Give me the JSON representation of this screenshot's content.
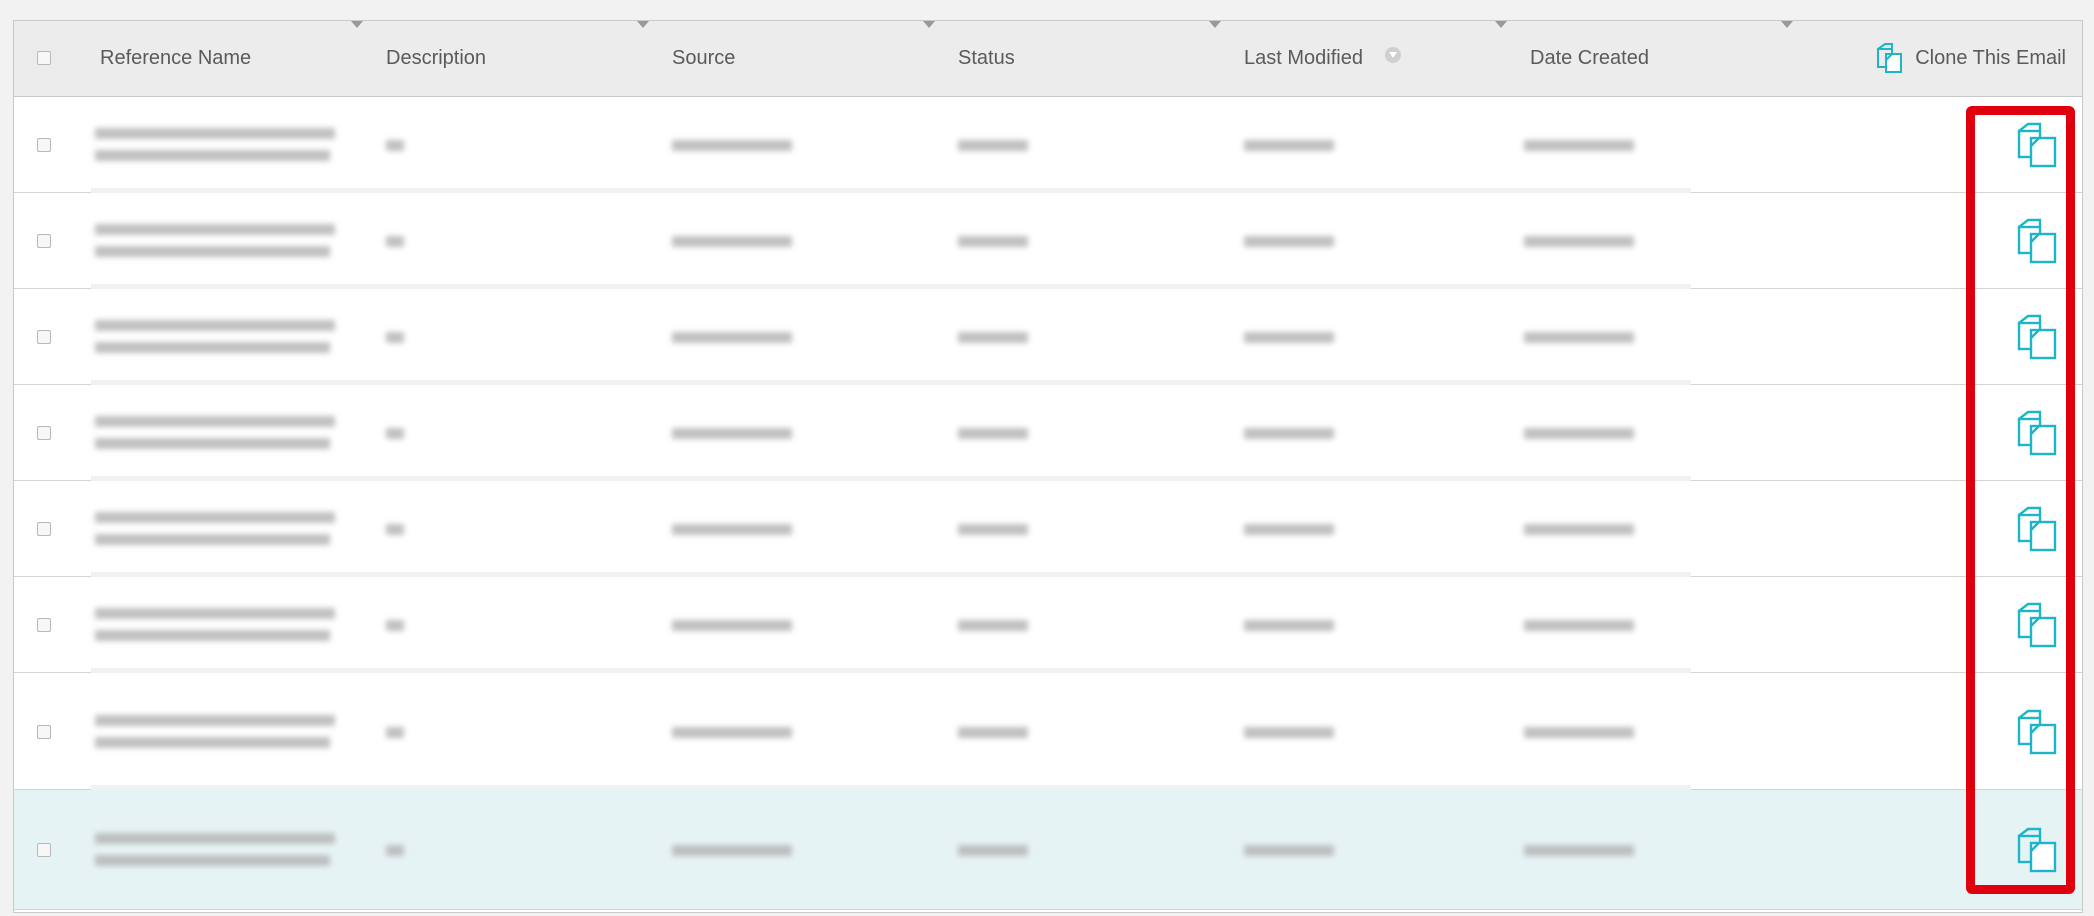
{
  "table": {
    "columns": [
      {
        "key": "reference_name",
        "label": "Reference Name"
      },
      {
        "key": "description",
        "label": "Description"
      },
      {
        "key": "source",
        "label": "Source"
      },
      {
        "key": "status",
        "label": "Status"
      },
      {
        "key": "last_modified",
        "label": "Last Modified"
      },
      {
        "key": "date_created",
        "label": "Date Created"
      }
    ],
    "clone_column_label": "Clone This Email",
    "sorted_column": "last_modified",
    "row_count": 8,
    "selected_row_index": 7,
    "row_text_note": "cell text obscured/blurred in screenshot"
  },
  "colors": {
    "accent": "#1fb5c9",
    "highlight_border": "#e0000d",
    "header_bg": "#ececec",
    "selected_row_bg": "#e6f3f4"
  },
  "icons": {
    "clone": "clone-icon",
    "sort": "sort-indicator-icon",
    "caret": "chevron-down-icon"
  }
}
